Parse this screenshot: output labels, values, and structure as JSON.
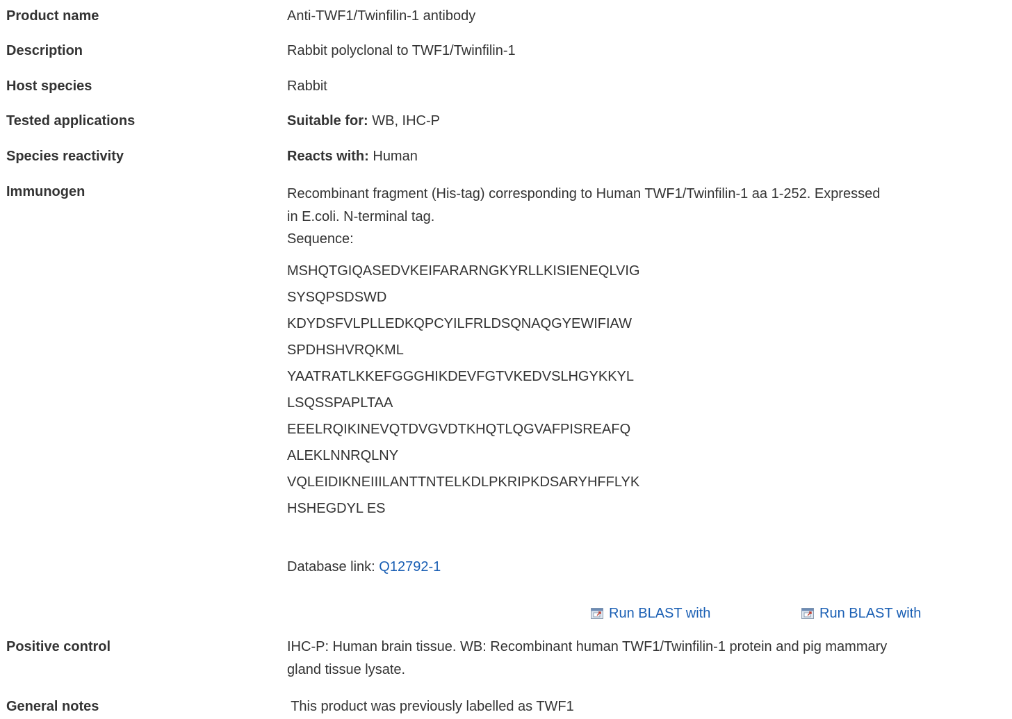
{
  "rows": {
    "product_name": {
      "label": "Product name",
      "value": "Anti-TWF1/Twinfilin-1 antibody"
    },
    "description": {
      "label": "Description",
      "value": "Rabbit polyclonal to TWF1/Twinfilin-1"
    },
    "host_species": {
      "label": "Host species",
      "value": "Rabbit"
    },
    "tested_applications": {
      "label": "Tested applications",
      "prefix": "Suitable for:",
      "value": " WB, IHC-P"
    },
    "species_reactivity": {
      "label": "Species reactivity",
      "prefix": "Reacts with:",
      "value": " Human"
    },
    "immunogen": {
      "label": "Immunogen",
      "line1": "Recombinant fragment (His-tag) corresponding to Human TWF1/Twinfilin-1 aa 1-252. Expressed",
      "line2": "in E.coli. N-terminal tag.",
      "sequence_label": "Sequence:",
      "sequence": [
        "MSHQTGIQASEDVKEIFARARNGKYRLLKISIENEQLVIG",
        "SYSQPSDSWD",
        "KDYDSFVLPLLEDKQPCYILFRLDSQNAQGYEWIFIAW",
        "SPDHSHVRQKML",
        "YAATRATLKKEFGGGHIKDEVFGTVKEDVSLHGYKKYL",
        "LSQSSPAPLTAA",
        "EEELRQIKINEVQTDVGVDTKHQTLQGVAFPISREAFQ",
        "ALEKLNNRQLNY",
        "VQLEIDIKNEIIILANTTNTELKDLPKRIPKDSARYHFFLYK",
        "HSHEGDYL ES"
      ],
      "database_link_label": "Database link: ",
      "database_link_value": "Q12792-1",
      "blast_1": "Run BLAST with",
      "blast_2": "Run BLAST with"
    },
    "positive_control": {
      "label": "Positive control",
      "line1": "IHC-P: Human brain tissue. WB: Recombinant human TWF1/Twinfilin-1 protein and pig mammary",
      "line2": "gland tissue lysate."
    },
    "general_notes": {
      "label": "General notes",
      "value": " This product was previously labelled as TWF1"
    }
  },
  "colors": {
    "text": "#333333",
    "link": "#1a5fb4"
  },
  "icons": {
    "blast": "external-window-icon"
  }
}
